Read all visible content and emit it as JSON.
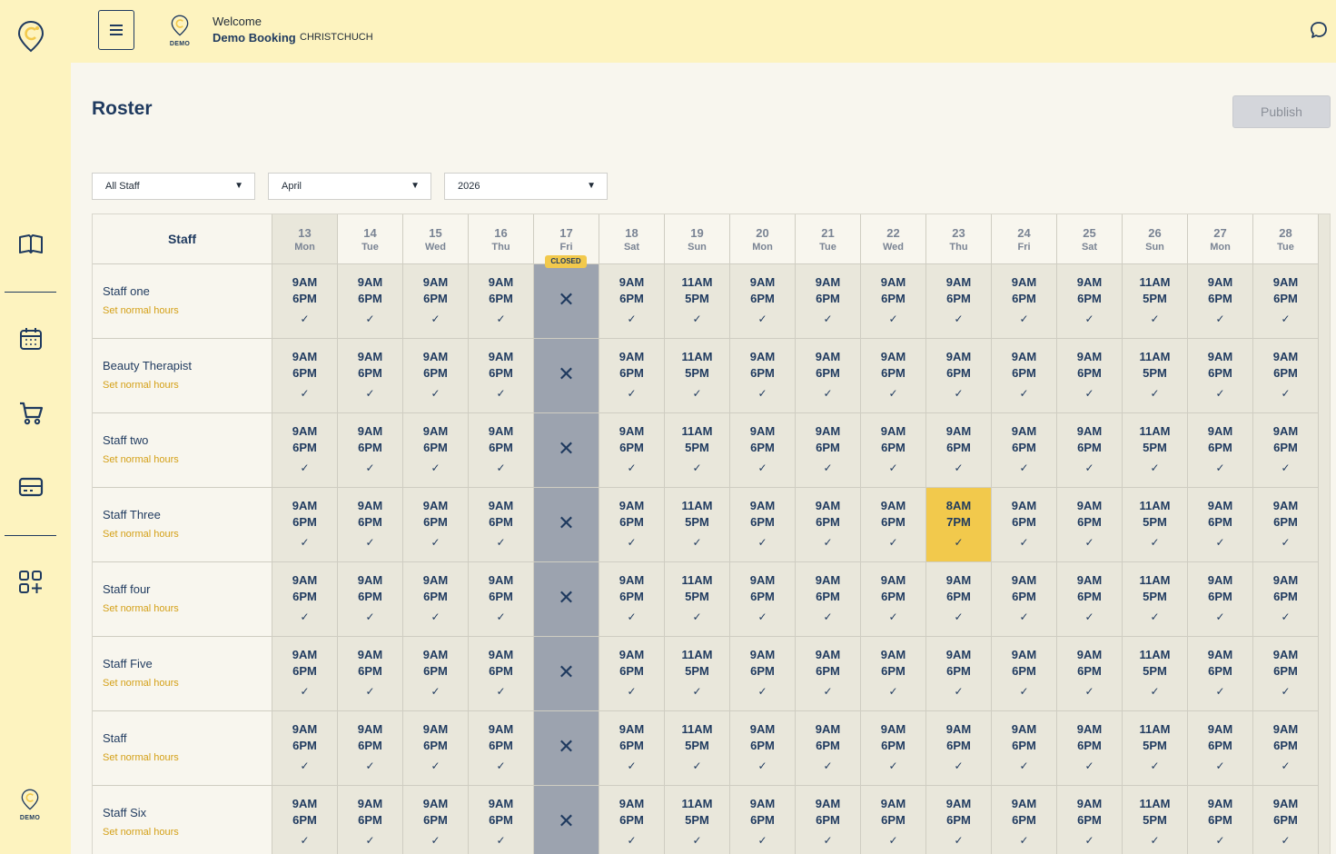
{
  "header": {
    "welcome": "Welcome",
    "business_name": "Demo Booking",
    "location": "CHRISTCHUCH",
    "logo_text": "DEMO"
  },
  "sidebar": {
    "items": [
      {
        "name": "book-icon"
      },
      {
        "name": "calendar-icon"
      },
      {
        "name": "cart-icon"
      },
      {
        "name": "card-icon"
      },
      {
        "name": "apps-add-icon"
      }
    ],
    "bottom_logo_text": "DEMO"
  },
  "page": {
    "title": "Roster",
    "publish_label": "Publish"
  },
  "filters": {
    "staff": "All Staff",
    "month": "April",
    "year": "2026"
  },
  "colors": {
    "accent": "#f2c94c",
    "primary": "#1f3a5f",
    "sidebar_bg": "#fdf3bf",
    "closed_bg": "#9ca3af",
    "link": "#d4a017"
  },
  "roster": {
    "staff_header": "Staff",
    "closed_label": "CLOSED",
    "set_hours_label": "Set normal hours",
    "days": [
      {
        "num": "13",
        "name": "Mon",
        "today": true
      },
      {
        "num": "14",
        "name": "Tue"
      },
      {
        "num": "15",
        "name": "Wed"
      },
      {
        "num": "16",
        "name": "Thu"
      },
      {
        "num": "17",
        "name": "Fri",
        "closed": true
      },
      {
        "num": "18",
        "name": "Sat"
      },
      {
        "num": "19",
        "name": "Sun"
      },
      {
        "num": "20",
        "name": "Mon"
      },
      {
        "num": "21",
        "name": "Tue"
      },
      {
        "num": "22",
        "name": "Wed"
      },
      {
        "num": "23",
        "name": "Thu"
      },
      {
        "num": "24",
        "name": "Fri"
      },
      {
        "num": "25",
        "name": "Sat"
      },
      {
        "num": "26",
        "name": "Sun"
      },
      {
        "num": "27",
        "name": "Mon"
      },
      {
        "num": "28",
        "name": "Tue"
      }
    ],
    "staff": [
      {
        "name": "Staff one",
        "shifts": [
          [
            "9AM",
            "6PM"
          ],
          [
            "9AM",
            "6PM"
          ],
          [
            "9AM",
            "6PM"
          ],
          [
            "9AM",
            "6PM"
          ],
          null,
          [
            "9AM",
            "6PM"
          ],
          [
            "11AM",
            "5PM"
          ],
          [
            "9AM",
            "6PM"
          ],
          [
            "9AM",
            "6PM"
          ],
          [
            "9AM",
            "6PM"
          ],
          [
            "9AM",
            "6PM"
          ],
          [
            "9AM",
            "6PM"
          ],
          [
            "9AM",
            "6PM"
          ],
          [
            "11AM",
            "5PM"
          ],
          [
            "9AM",
            "6PM"
          ],
          [
            "9AM",
            "6PM"
          ]
        ]
      },
      {
        "name": "Beauty Therapist",
        "shifts": [
          [
            "9AM",
            "6PM"
          ],
          [
            "9AM",
            "6PM"
          ],
          [
            "9AM",
            "6PM"
          ],
          [
            "9AM",
            "6PM"
          ],
          null,
          [
            "9AM",
            "6PM"
          ],
          [
            "11AM",
            "5PM"
          ],
          [
            "9AM",
            "6PM"
          ],
          [
            "9AM",
            "6PM"
          ],
          [
            "9AM",
            "6PM"
          ],
          [
            "9AM",
            "6PM"
          ],
          [
            "9AM",
            "6PM"
          ],
          [
            "9AM",
            "6PM"
          ],
          [
            "11AM",
            "5PM"
          ],
          [
            "9AM",
            "6PM"
          ],
          [
            "9AM",
            "6PM"
          ]
        ]
      },
      {
        "name": "Staff two",
        "shifts": [
          [
            "9AM",
            "6PM"
          ],
          [
            "9AM",
            "6PM"
          ],
          [
            "9AM",
            "6PM"
          ],
          [
            "9AM",
            "6PM"
          ],
          null,
          [
            "9AM",
            "6PM"
          ],
          [
            "11AM",
            "5PM"
          ],
          [
            "9AM",
            "6PM"
          ],
          [
            "9AM",
            "6PM"
          ],
          [
            "9AM",
            "6PM"
          ],
          [
            "9AM",
            "6PM"
          ],
          [
            "9AM",
            "6PM"
          ],
          [
            "9AM",
            "6PM"
          ],
          [
            "11AM",
            "5PM"
          ],
          [
            "9AM",
            "6PM"
          ],
          [
            "9AM",
            "6PM"
          ]
        ]
      },
      {
        "name": "Staff Three",
        "highlight_index": 10,
        "shifts": [
          [
            "9AM",
            "6PM"
          ],
          [
            "9AM",
            "6PM"
          ],
          [
            "9AM",
            "6PM"
          ],
          [
            "9AM",
            "6PM"
          ],
          null,
          [
            "9AM",
            "6PM"
          ],
          [
            "11AM",
            "5PM"
          ],
          [
            "9AM",
            "6PM"
          ],
          [
            "9AM",
            "6PM"
          ],
          [
            "9AM",
            "6PM"
          ],
          [
            "8AM",
            "7PM"
          ],
          [
            "9AM",
            "6PM"
          ],
          [
            "9AM",
            "6PM"
          ],
          [
            "11AM",
            "5PM"
          ],
          [
            "9AM",
            "6PM"
          ],
          [
            "9AM",
            "6PM"
          ]
        ]
      },
      {
        "name": "Staff four",
        "shifts": [
          [
            "9AM",
            "6PM"
          ],
          [
            "9AM",
            "6PM"
          ],
          [
            "9AM",
            "6PM"
          ],
          [
            "9AM",
            "6PM"
          ],
          null,
          [
            "9AM",
            "6PM"
          ],
          [
            "11AM",
            "5PM"
          ],
          [
            "9AM",
            "6PM"
          ],
          [
            "9AM",
            "6PM"
          ],
          [
            "9AM",
            "6PM"
          ],
          [
            "9AM",
            "6PM"
          ],
          [
            "9AM",
            "6PM"
          ],
          [
            "9AM",
            "6PM"
          ],
          [
            "11AM",
            "5PM"
          ],
          [
            "9AM",
            "6PM"
          ],
          [
            "9AM",
            "6PM"
          ]
        ]
      },
      {
        "name": "Staff Five",
        "shifts": [
          [
            "9AM",
            "6PM"
          ],
          [
            "9AM",
            "6PM"
          ],
          [
            "9AM",
            "6PM"
          ],
          [
            "9AM",
            "6PM"
          ],
          null,
          [
            "9AM",
            "6PM"
          ],
          [
            "11AM",
            "5PM"
          ],
          [
            "9AM",
            "6PM"
          ],
          [
            "9AM",
            "6PM"
          ],
          [
            "9AM",
            "6PM"
          ],
          [
            "9AM",
            "6PM"
          ],
          [
            "9AM",
            "6PM"
          ],
          [
            "9AM",
            "6PM"
          ],
          [
            "11AM",
            "5PM"
          ],
          [
            "9AM",
            "6PM"
          ],
          [
            "9AM",
            "6PM"
          ]
        ]
      },
      {
        "name": "Staff",
        "shifts": [
          [
            "9AM",
            "6PM"
          ],
          [
            "9AM",
            "6PM"
          ],
          [
            "9AM",
            "6PM"
          ],
          [
            "9AM",
            "6PM"
          ],
          null,
          [
            "9AM",
            "6PM"
          ],
          [
            "11AM",
            "5PM"
          ],
          [
            "9AM",
            "6PM"
          ],
          [
            "9AM",
            "6PM"
          ],
          [
            "9AM",
            "6PM"
          ],
          [
            "9AM",
            "6PM"
          ],
          [
            "9AM",
            "6PM"
          ],
          [
            "9AM",
            "6PM"
          ],
          [
            "11AM",
            "5PM"
          ],
          [
            "9AM",
            "6PM"
          ],
          [
            "9AM",
            "6PM"
          ]
        ]
      },
      {
        "name": "Staff Six",
        "shifts": [
          [
            "9AM",
            "6PM"
          ],
          [
            "9AM",
            "6PM"
          ],
          [
            "9AM",
            "6PM"
          ],
          [
            "9AM",
            "6PM"
          ],
          null,
          [
            "9AM",
            "6PM"
          ],
          [
            "11AM",
            "5PM"
          ],
          [
            "9AM",
            "6PM"
          ],
          [
            "9AM",
            "6PM"
          ],
          [
            "9AM",
            "6PM"
          ],
          [
            "9AM",
            "6PM"
          ],
          [
            "9AM",
            "6PM"
          ],
          [
            "9AM",
            "6PM"
          ],
          [
            "11AM",
            "5PM"
          ],
          [
            "9AM",
            "6PM"
          ],
          [
            "9AM",
            "6PM"
          ]
        ]
      }
    ]
  }
}
